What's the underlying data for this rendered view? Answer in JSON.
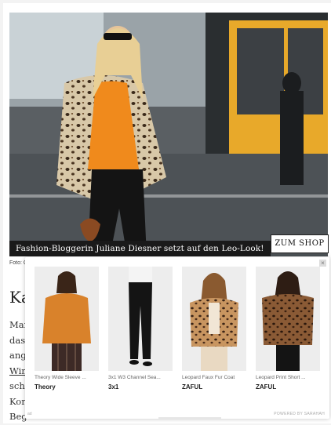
{
  "article": {
    "caption": "Fashion-Bloggerin Juliane Diesner setzt auf den Leo-Look!",
    "shop_button": "ZUM SHOP",
    "photo_credit": "Foto: G",
    "heading": "Ka",
    "lines": [
      "Mar",
      "das",
      "ang",
      "Win",
      "schi",
      "Kor",
      "Beg"
    ]
  },
  "overlay": {
    "close": "×",
    "footer_left": "ad",
    "footer_right": "POWERED BY SARAHAH",
    "products": [
      {
        "name": "Theory Wide Sleeve ...",
        "brand": "Theory",
        "icon": "orange-sweater"
      },
      {
        "name": "3x1 W3 Channel Sea...",
        "brand": "3x1",
        "icon": "black-jeans"
      },
      {
        "name": "Leopard Faux Fur Coat",
        "brand": "ZAFUL",
        "icon": "leopard-coat"
      },
      {
        "name": "Leopard Print Short ...",
        "brand": "ZAFUL",
        "icon": "leopard-jacket"
      }
    ]
  },
  "colors": {
    "accent": "#f08a1c",
    "leopard": "#d8c8a8",
    "bus": "#e8a92a"
  }
}
